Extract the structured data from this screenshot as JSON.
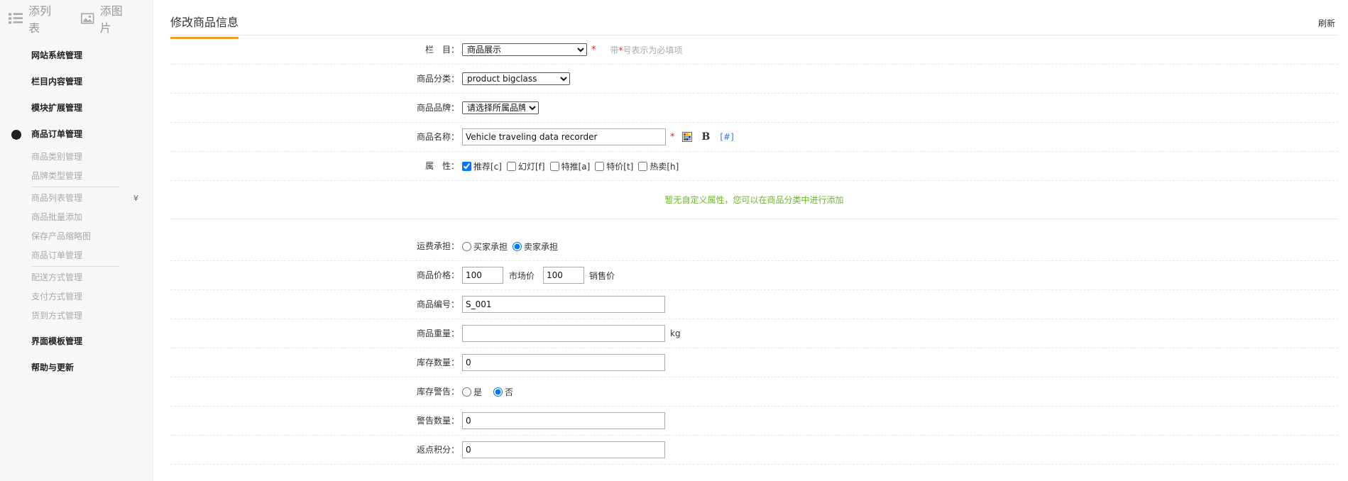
{
  "sidebar": {
    "tools": [
      {
        "label": "添列表",
        "icon": "list-icon"
      },
      {
        "label": "添图片",
        "icon": "image-icon"
      }
    ],
    "menus": [
      {
        "label": "网站系统管理"
      },
      {
        "label": "栏目内容管理"
      },
      {
        "label": "模块扩展管理"
      },
      {
        "label": "商品订单管理",
        "expanded": true
      }
    ],
    "sub_items": [
      {
        "label": "商品类别管理"
      },
      {
        "label": "品牌类型管理"
      },
      {
        "label": "商品列表管理",
        "arrow": "¥"
      },
      {
        "label": "商品批量添加"
      },
      {
        "label": "保存产品缩略图"
      },
      {
        "label": "商品订单管理"
      },
      {
        "label": "配送方式管理"
      },
      {
        "label": "支付方式管理"
      },
      {
        "label": "货到方式管理"
      }
    ],
    "bottom_menus": [
      {
        "label": "界面模板管理"
      },
      {
        "label": "帮助与更新"
      }
    ]
  },
  "header": {
    "title": "修改商品信息",
    "refresh": "刷新"
  },
  "form": {
    "column": {
      "label": "栏　目：",
      "value": "商品展示",
      "hint_prefix": "带",
      "hint_star": "*",
      "hint_suffix": "号表示为必填项"
    },
    "category": {
      "label": "商品分类：",
      "value": "product bigclass"
    },
    "brand": {
      "label": "商品品牌：",
      "value": "请选择所属品牌"
    },
    "name": {
      "label": "商品名称：",
      "value": "Vehicle traveling data recorder",
      "bold": "B",
      "link": "[#]"
    },
    "attributes": {
      "label": "属　性：",
      "options": [
        {
          "label": "推荐[c]",
          "checked": true
        },
        {
          "label": "幻灯[f]",
          "checked": false
        },
        {
          "label": "特推[a]",
          "checked": false
        },
        {
          "label": "特价[t]",
          "checked": false
        },
        {
          "label": "热卖[h]",
          "checked": false
        }
      ]
    },
    "notice": "暂无自定义属性，您可以在商品分类中进行添加",
    "shipping": {
      "label": "运费承担：",
      "options": [
        {
          "label": "买家承担",
          "checked": false
        },
        {
          "label": "卖家承担",
          "checked": true
        }
      ]
    },
    "price": {
      "label": "商品价格：",
      "market_value": "100",
      "market_unit": "市场价",
      "sale_value": "100",
      "sale_unit": "销售价"
    },
    "sku": {
      "label": "商品编号：",
      "value": "S_001"
    },
    "weight": {
      "label": "商品重量：",
      "value": "",
      "unit": "kg"
    },
    "stock": {
      "label": "库存数量：",
      "value": "0"
    },
    "stock_warning": {
      "label": "库存警告：",
      "options": [
        {
          "label": "是",
          "checked": false
        },
        {
          "label": "否",
          "checked": true
        }
      ]
    },
    "warning_qty": {
      "label": "警告数量：",
      "value": "0"
    },
    "points": {
      "label": "返点积分：",
      "value": "0"
    }
  },
  "colors": {
    "accent": "#f0a020",
    "required": "#e22222",
    "notice": "#6cb52d",
    "link": "#2a7ae2"
  }
}
